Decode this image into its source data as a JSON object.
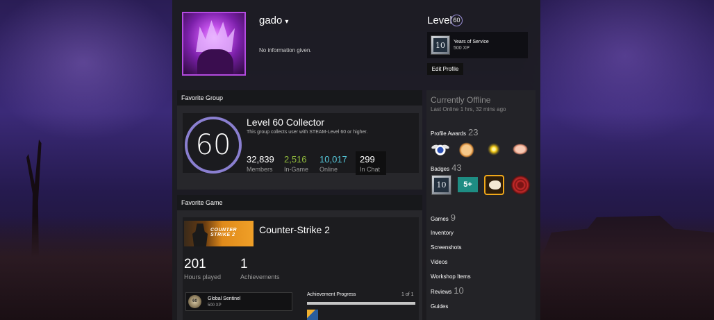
{
  "profile": {
    "username": "gado",
    "bio": "No information given."
  },
  "level": {
    "label": "Level",
    "value": "60",
    "years_of_service": {
      "badge_text": "10",
      "title": "Years of Service",
      "xp": "500 XP"
    },
    "edit_button": "Edit Profile"
  },
  "favorite_group": {
    "header": "Favorite Group",
    "ring_number": "60",
    "name": "Level 60 Collector",
    "description": "This group collects user with STEAM-Level 60 or higher.",
    "stats": [
      {
        "value": "32,839",
        "label": "Members",
        "color": "#ffffff"
      },
      {
        "value": "2,516",
        "label": "In-Game",
        "color": "#90ba3c"
      },
      {
        "value": "10,017",
        "label": "Online",
        "color": "#57cbde"
      },
      {
        "value": "299",
        "label": "In Chat",
        "color": "#ffffff"
      }
    ]
  },
  "favorite_game": {
    "header": "Favorite Game",
    "image_text_line1": "COUNTER",
    "image_text_line2": "STRIKE 2",
    "name": "Counter-Strike 2",
    "hours_value": "201",
    "hours_label": "Hours played",
    "achievements_value": "1",
    "achievements_label": "Achievements",
    "achievement": {
      "icon_text": "60",
      "name": "Global Sentinel",
      "xp": "500 XP"
    },
    "progress": {
      "label": "Achievement Progress",
      "count": "1 of 1",
      "fraction": 1.0
    }
  },
  "status": {
    "state": "Currently Offline",
    "last_online": "Last Online 1 hrs, 32 mins ago"
  },
  "sidebar": {
    "awards": {
      "label": "Profile Awards",
      "count": "23",
      "icons": [
        "winged-emblem-icon",
        "cookie-face-icon",
        "sun-icon",
        "brain-icon"
      ]
    },
    "badges": {
      "label": "Badges",
      "count": "43",
      "first_badge_text": "10",
      "second_badge_text": "5+",
      "icons": [
        "years-of-service-badge-icon",
        "five-plus-badge-icon",
        "ram-badge-icon",
        "red-rose-badge-icon"
      ]
    },
    "games": {
      "label": "Games",
      "count": "9"
    },
    "links": [
      "Inventory",
      "Screenshots",
      "Videos",
      "Workshop Items"
    ],
    "reviews": {
      "label": "Reviews",
      "count": "10"
    },
    "guides": "Guides"
  }
}
